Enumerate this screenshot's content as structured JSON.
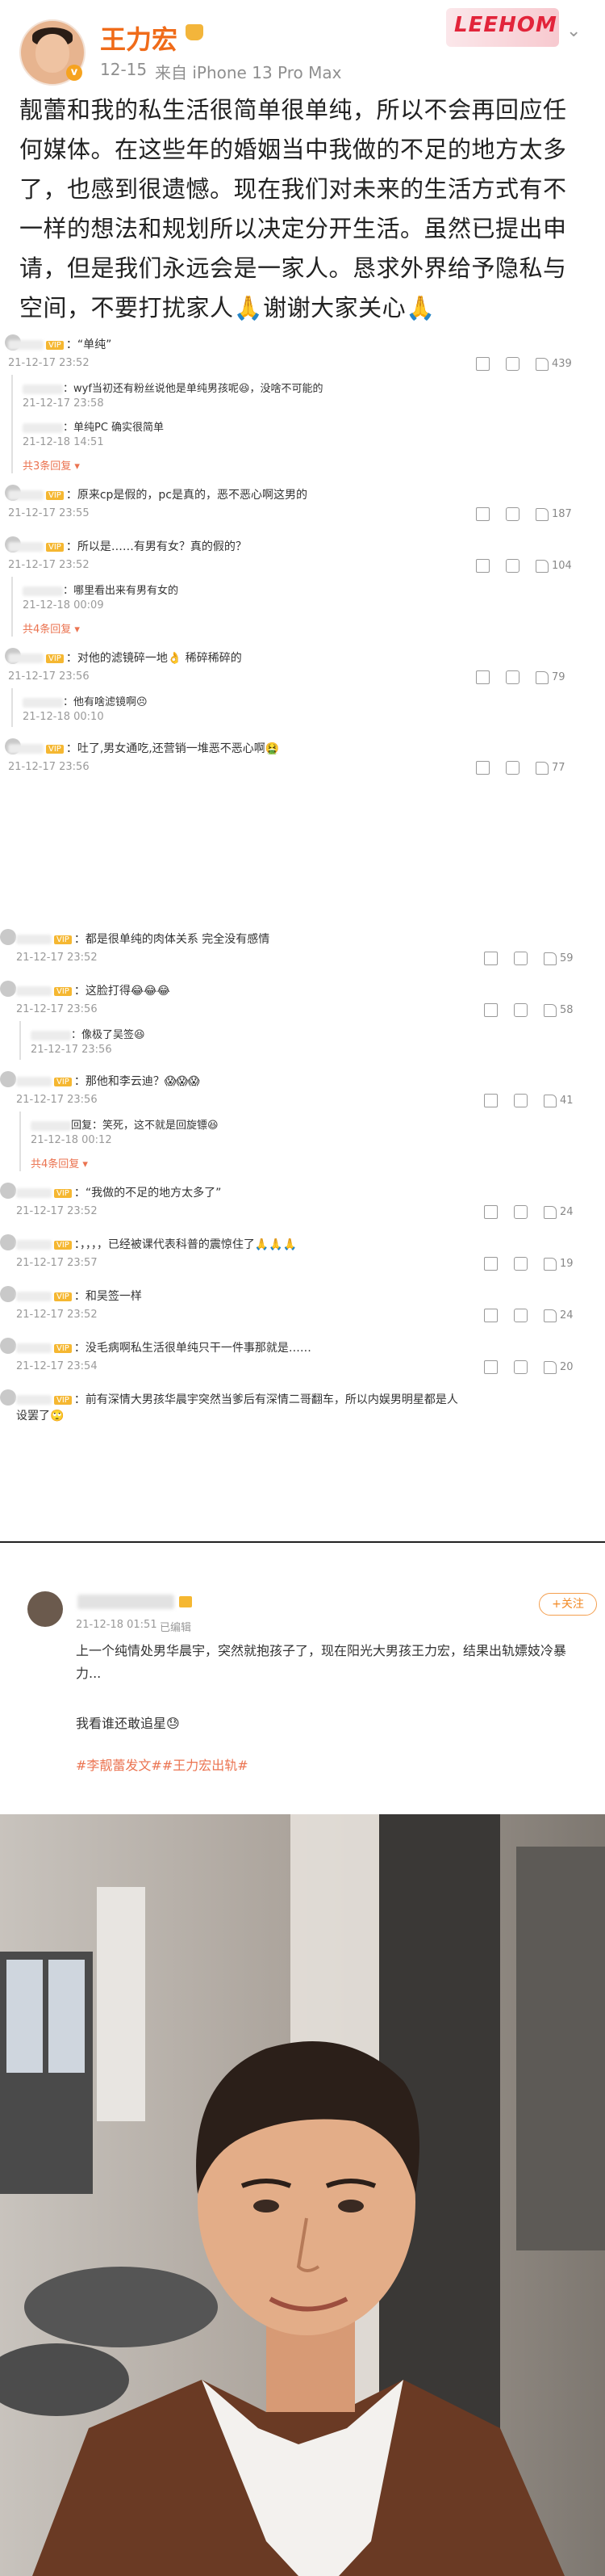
{
  "post": {
    "author": "王力宏",
    "date": "12-15",
    "source": "来自 iPhone 13 Pro Max",
    "badge_text": "LEEHOM",
    "text": "靓蕾和我的私生活很简单很单纯，所以不会再回应任何媒体。在这些年的婚姻当中我做的不足的地方太多了，也感到很遗憾。现在我们对未来的生活方式有不一样的想法和规划所以决定分开生活。虽然已提出申请，但是我们永远会是一家人。恳求外界给予隐私与空间，不要打扰家人🙏谢谢大家关心🙏"
  },
  "comments": [
    {
      "text": "：“单纯”",
      "time": "21-12-17 23:52",
      "likes": "439",
      "replies": [
        {
          "text": "：wyf当初还有粉丝说他是单纯男孩呢😆，没啥不可能的",
          "time": "21-12-17 23:58"
        },
        {
          "text": "：单纯PC 确实很简单",
          "time": "21-12-18 14:51"
        }
      ],
      "more": "共3条回复 ▾"
    },
    {
      "text": "：原来cp是假的，pc是真的，恶不恶心啊这男的",
      "time": "21-12-17 23:55",
      "likes": "187"
    },
    {
      "text": "：所以是……有男有女？真的假的？",
      "time": "21-12-17 23:52",
      "likes": "104",
      "replies": [
        {
          "text": "：哪里看出来有男有女的",
          "time": "21-12-18 00:09"
        }
      ],
      "more": "共4条回复 ▾"
    },
    {
      "text": "：对他的滤镜碎一地👌 稀碎稀碎的",
      "time": "21-12-17 23:56",
      "likes": "79",
      "replies": [
        {
          "text": "：他有啥滤镜啊😣",
          "time": "21-12-18 00:10"
        }
      ]
    },
    {
      "text": "：吐了,男女通吃,还营销一堆恶不恶心啊🤮",
      "time": "21-12-17 23:56",
      "likes": "77"
    }
  ],
  "comments2": [
    {
      "text": "：都是很单纯的肉体关系 完全没有感情",
      "time": "21-12-17 23:52",
      "likes": "59"
    },
    {
      "text": "：这脸打得😂😂😂",
      "time": "21-12-17 23:56",
      "likes": "58",
      "replies": [
        {
          "text": "：像极了吴签😆",
          "time": "21-12-17 23:56"
        }
      ]
    },
    {
      "text": "：那他和李云迪？😱😱😱",
      "time": "21-12-17 23:56",
      "likes": "41",
      "replies": [
        {
          "text": "回复：笑死，这不就是回旋镖😆",
          "time": "21-12-18 00:12"
        }
      ],
      "more": "共4条回复 ▾"
    },
    {
      "text": "：“我做的不足的地方太多了”",
      "time": "21-12-17 23:52",
      "likes": "24"
    },
    {
      "text": "：，，，，已经被课代表科普的震惊住了🙏🙏🙏",
      "time": "21-12-17 23:57",
      "likes": "19"
    },
    {
      "text": "：和吴签一样",
      "time": "21-12-17 23:52",
      "likes": "24"
    },
    {
      "text": "：没毛病啊私生活很单纯只干一件事那就是……",
      "time": "21-12-17 23:54",
      "likes": "20"
    },
    {
      "text": "：前有深情大男孩华晨宇突然当爹后有深情二哥翻车，所以内娱男明星都是人设罢了🙄",
      "time": "",
      "likes": ""
    }
  ],
  "repost": {
    "date": "21-12-18 01:51",
    "edited": "已编辑",
    "follow": "+关注",
    "text1": "上一个纯情处男华晨宇，突然就抱孩子了，现在阳光大男孩王力宏，结果出轨嫖妓冷暴力...",
    "text2": "我看谁还敢追星😓",
    "tags": "#李靓蕾发文##王力宏出轨#"
  },
  "icons": [
    "share-icon",
    "comment-icon",
    "like-icon",
    "verified-icon",
    "chevron-down-icon"
  ],
  "colors": {
    "name": "#f06b19",
    "more": "#eb7350",
    "tag": "#eb7350"
  }
}
